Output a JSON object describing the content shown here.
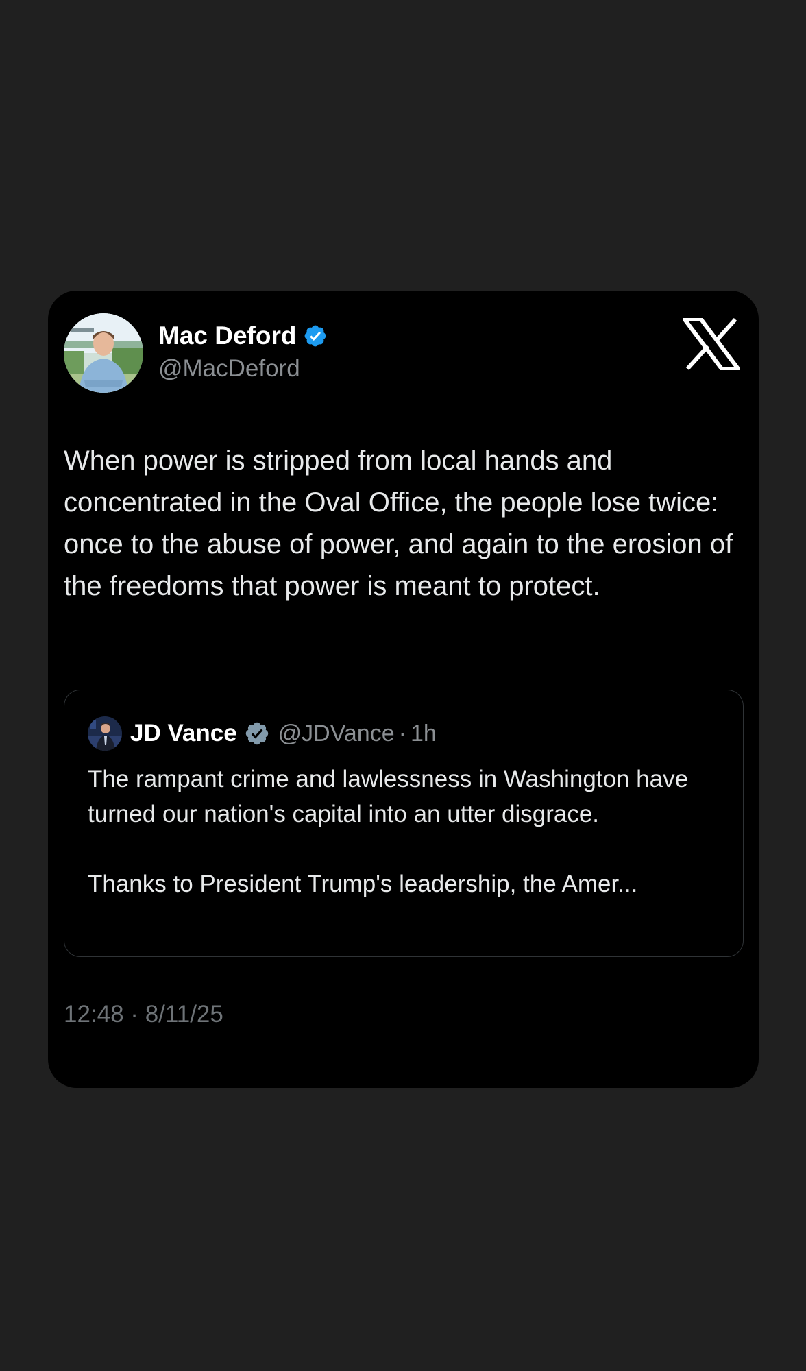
{
  "author": {
    "name": "Mac Deford",
    "handle": "@MacDeford",
    "verified": true,
    "badge_color": "#1d9bf0"
  },
  "tweet": {
    "text": "When power is stripped from local hands and concentrated in the Oval Office, the people lose twice: once to the abuse of power, and again to the erosion of the freedoms that power is meant to protect."
  },
  "quoted": {
    "name": "JD Vance",
    "handle": "@JDVance",
    "separator": "·",
    "time": "1h",
    "badge_color": "#829aab",
    "paragraphs": [
      "The rampant crime and lawlessness in Washington have turned our nation's capital into an utter disgrace.",
      "Thanks to President Trump's leadership, the Amer..."
    ]
  },
  "footer": {
    "timestamp": "12:48 · 8/11/25"
  },
  "brand": {
    "logo_icon": "x-logo-icon"
  }
}
